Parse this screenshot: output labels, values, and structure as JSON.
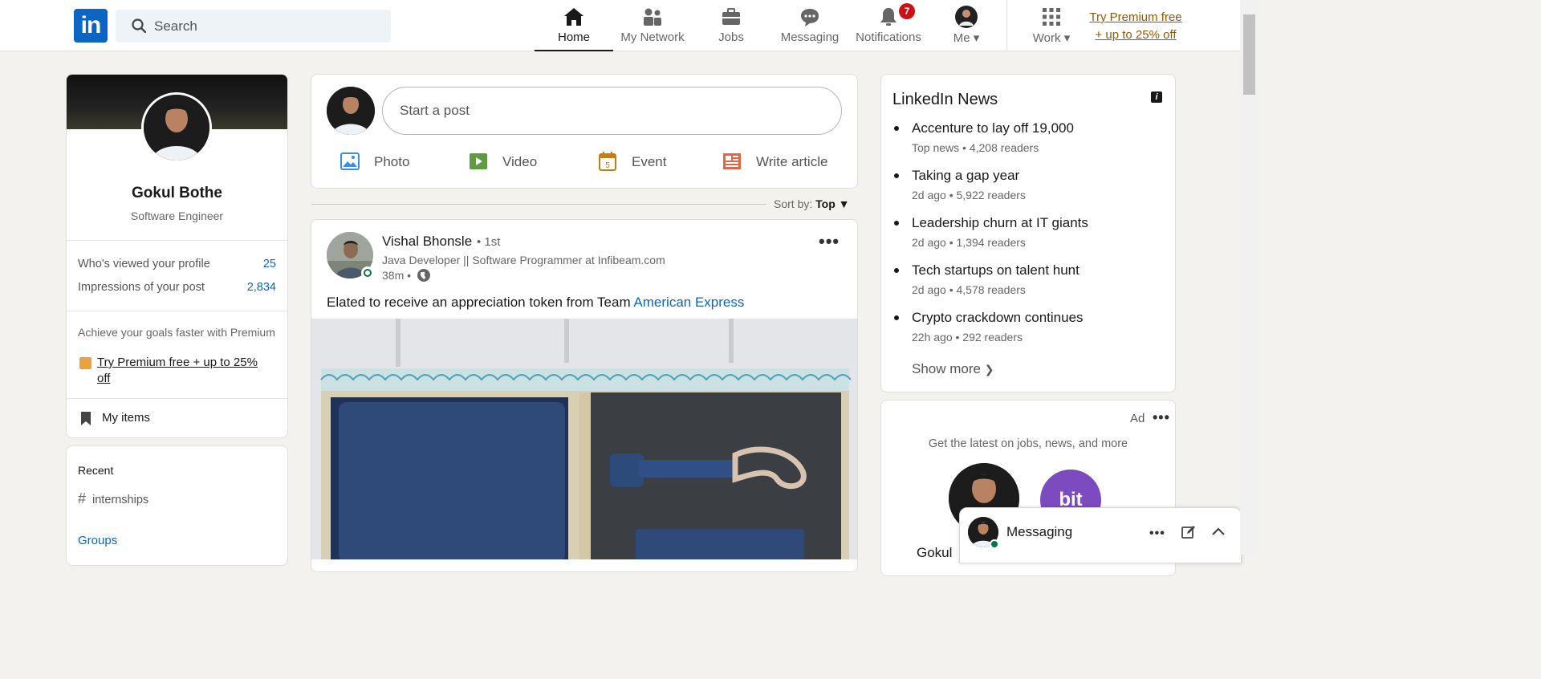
{
  "nav": {
    "search_placeholder": "Search",
    "items": [
      {
        "label": "Home",
        "icon": "home-icon"
      },
      {
        "label": "My Network",
        "icon": "network-icon"
      },
      {
        "label": "Jobs",
        "icon": "briefcase-icon"
      },
      {
        "label": "Messaging",
        "icon": "chat-icon"
      },
      {
        "label": "Notifications",
        "icon": "bell-icon",
        "badge": "7"
      },
      {
        "label": "Me",
        "icon": "avatar-icon"
      },
      {
        "label": "Work",
        "icon": "grid-icon"
      }
    ],
    "premium_line1": "Try Premium free",
    "premium_line2": "+ up to 25% off"
  },
  "profile": {
    "name": "Gokul Bothe",
    "title": "Software Engineer",
    "stats": [
      {
        "label": "Who's viewed your profile",
        "value": "25"
      },
      {
        "label": "Impressions of your post",
        "value": "2,834"
      }
    ],
    "premium_text": "Achieve your goals faster with Premium",
    "premium_link": "Try Premium free + up to 25% off",
    "my_items": "My items"
  },
  "recent": {
    "heading": "Recent",
    "items": [
      "internships"
    ],
    "groups": "Groups"
  },
  "share": {
    "placeholder": "Start a post",
    "actions": [
      {
        "label": "Photo",
        "icon": "photo-icon",
        "color": "#378fe9"
      },
      {
        "label": "Video",
        "icon": "video-icon",
        "color": "#5f9b41"
      },
      {
        "label": "Event",
        "icon": "calendar-icon",
        "color": "#c37d16",
        "day": "5"
      },
      {
        "label": "Write article",
        "icon": "article-icon",
        "color": "#e06847"
      }
    ]
  },
  "sort": {
    "prefix": "Sort by:",
    "value": "Top"
  },
  "post": {
    "author": "Vishal Bhonsle",
    "degree": "• 1st",
    "headline": "Java Developer || Software Programmer at Infibeam.com",
    "time": "38m •",
    "text": "Elated to receive an appreciation token from Team ",
    "mention": "American Express"
  },
  "news": {
    "title": "LinkedIn News",
    "items": [
      {
        "headline": "Accenture to lay off 19,000",
        "meta": "Top news • 4,208 readers"
      },
      {
        "headline": "Taking a gap year",
        "meta": "2d ago • 5,922 readers"
      },
      {
        "headline": "Leadership churn at IT giants",
        "meta": "2d ago • 1,394 readers"
      },
      {
        "headline": "Tech startups on talent hunt",
        "meta": "2d ago • 4,578 readers"
      },
      {
        "headline": "Crypto crackdown continues",
        "meta": "22h ago • 292 readers"
      }
    ],
    "show_more": "Show more"
  },
  "ad": {
    "label": "Ad",
    "text": "Get the latest on jobs, news, and more",
    "brand": "bit",
    "name_partial": "Gokul"
  },
  "messaging": {
    "label": "Messaging"
  },
  "colors": {
    "brand": "#0a66c2",
    "badge": "#cc1016",
    "premium": "#915907"
  }
}
